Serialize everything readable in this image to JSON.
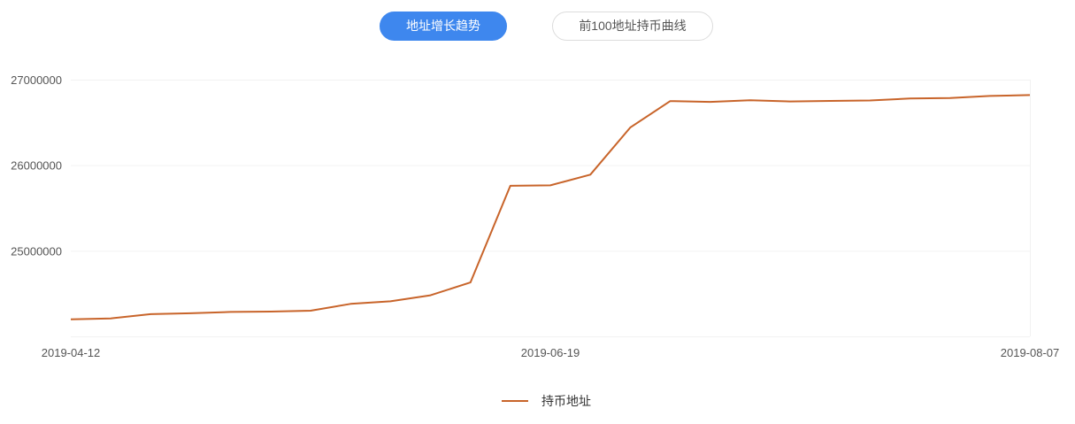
{
  "tabs": [
    {
      "label": "地址增长趋势",
      "active": true
    },
    {
      "label": "前100地址持币曲线",
      "active": false
    }
  ],
  "colors": {
    "accent": "#3e87ee",
    "series": "#c8642a"
  },
  "chart_data": {
    "type": "line",
    "title": "",
    "xlabel": "",
    "ylabel": "",
    "ylim": [
      24000000,
      27000000
    ],
    "yticks": [
      "27000000",
      "26000000",
      "25000000"
    ],
    "yticks_values": [
      27000000,
      26000000,
      25000000
    ],
    "xticks": [
      "2019-04-12",
      "2019-06-19",
      "2019-08-07"
    ],
    "xticks_index": [
      0,
      12,
      24
    ],
    "grid": true,
    "legend": "bottom-center",
    "series": [
      {
        "name": "持币地址",
        "values": [
          24200000,
          24210000,
          24260000,
          24270000,
          24285000,
          24290000,
          24300000,
          24380000,
          24410000,
          24480000,
          24630000,
          25760000,
          25765000,
          25890000,
          26440000,
          26750000,
          26740000,
          26760000,
          26745000,
          26752000,
          26757000,
          26780000,
          26785000,
          26810000,
          26820000
        ]
      }
    ]
  }
}
